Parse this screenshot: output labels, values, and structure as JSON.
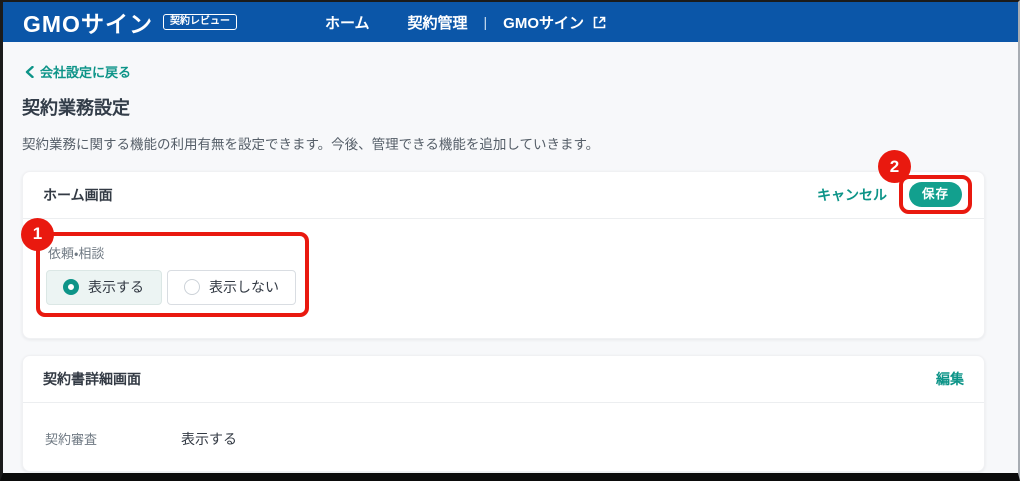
{
  "nav": {
    "logo": "GMOサイン",
    "logo_badge": "契約レビュー",
    "items": [
      {
        "label": "ホーム"
      },
      {
        "label": "契約管理"
      }
    ],
    "separator": "|",
    "external_item": "GMOサイン"
  },
  "page": {
    "back_link": "会社設定に戻る",
    "title": "契約業務設定",
    "description": "契約業務に関する機能の利用有無を設定できます。今後、管理できる機能を追加していきます。"
  },
  "home_card": {
    "title": "ホーム画面",
    "cancel_label": "キャンセル",
    "save_label": "保存",
    "field_label": "依頼・相談",
    "options": [
      {
        "label": "表示する",
        "selected": true
      },
      {
        "label": "表示しない",
        "selected": false
      }
    ]
  },
  "detail_card": {
    "title": "契約書詳細画面",
    "edit_label": "編集",
    "rows": [
      {
        "label": "契約審査",
        "value": "表示する"
      }
    ]
  },
  "annotations": {
    "step1": "1",
    "step2": "2"
  },
  "colors": {
    "navbar_blue": "#0b56a8",
    "accent_teal": "#0d9488",
    "save_button_teal": "#12a08e",
    "annotation_red": "#e9190f",
    "page_background": "#f7f8fa"
  }
}
